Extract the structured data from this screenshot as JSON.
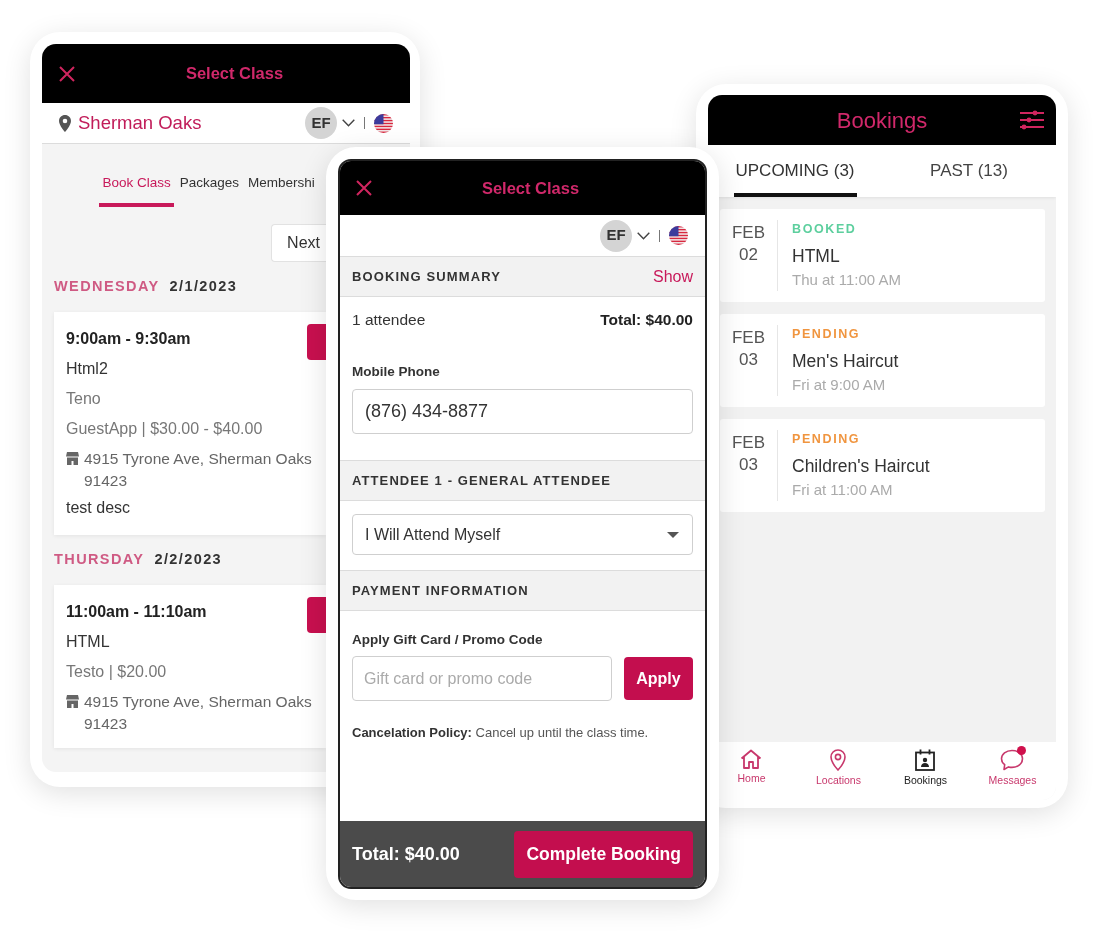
{
  "select_class_screen": {
    "title": "Select Class",
    "location": "Sherman Oaks",
    "avatar_initials": "EF",
    "tabs": [
      {
        "label": "Book Class",
        "selected": true
      },
      {
        "label": "Packages",
        "selected": false
      },
      {
        "label": "Membershi",
        "selected": false
      }
    ],
    "next_button": "Next",
    "days": [
      {
        "weekday": "WEDNESDAY",
        "date": "2/1/2023",
        "classes": [
          {
            "time": "9:00am - 9:30am",
            "name": "Html2",
            "details": [
              "Teno",
              "GuestApp | $30.00 - $40.00"
            ],
            "address": [
              "4915 Tyrone Ave, Sherman Oaks",
              "91423"
            ],
            "description": "test desc"
          }
        ]
      },
      {
        "weekday": "THURSDAY",
        "date": "2/2/2023",
        "classes": [
          {
            "time": "11:00am - 11:10am",
            "name": "HTML",
            "details": [
              "Testo | $20.00"
            ],
            "address": [
              "4915 Tyrone Ave, Sherman Oaks",
              "91423"
            ]
          }
        ]
      }
    ]
  },
  "booking_screen": {
    "title": "Select Class",
    "avatar_initials": "EF",
    "summary": {
      "heading": "BOOKING SUMMARY",
      "toggle": "Show",
      "attendees": "1 attendee",
      "total": "Total: $40.00"
    },
    "phone_field": {
      "label": "Mobile Phone",
      "value": "(876) 434-8877"
    },
    "attendee": {
      "heading": "ATTENDEE 1 - GENERAL ATTENDEE",
      "choice": "I Will Attend Myself"
    },
    "payment": {
      "heading": "PAYMENT INFORMATION",
      "promo_field": {
        "label": "Apply Gift Card / Promo Code",
        "placeholder": "Gift card or promo code"
      },
      "apply_button": "Apply"
    },
    "policy": "**Cancelation Policy:** Cancel up until the class time.",
    "footer": {
      "total": "Total: $40.00",
      "button": "Complete Booking"
    }
  },
  "bookings_screen": {
    "title": "Bookings",
    "tabs": [
      {
        "label": "UPCOMING (3)",
        "selected": true
      },
      {
        "label": "PAST (13)",
        "selected": false
      }
    ],
    "bookings": [
      {
        "month": "FEB",
        "day": "02",
        "status": "BOOKED",
        "color": "#5dcf9e",
        "title": "HTML",
        "when": "Thu at 11:00 AM"
      },
      {
        "month": "FEB",
        "day": "03",
        "status": "PENDING",
        "color": "#f0953f",
        "title": "Men's Haircut",
        "when": "Fri at 9:00 AM"
      },
      {
        "month": "FEB",
        "day": "03",
        "status": "PENDING",
        "color": "#f0953f",
        "title": "Children's Haircut",
        "when": "Fri at 11:00 AM"
      }
    ],
    "nav": [
      {
        "kind": "home",
        "label": "Home",
        "selected": false,
        "unread": false
      },
      {
        "kind": "pin",
        "label": "Locations",
        "selected": false,
        "unread": false
      },
      {
        "kind": "calendar",
        "label": "Bookings",
        "selected": true,
        "unread": false
      },
      {
        "kind": "chat",
        "label": "Messages",
        "selected": false,
        "unread": true
      }
    ]
  }
}
